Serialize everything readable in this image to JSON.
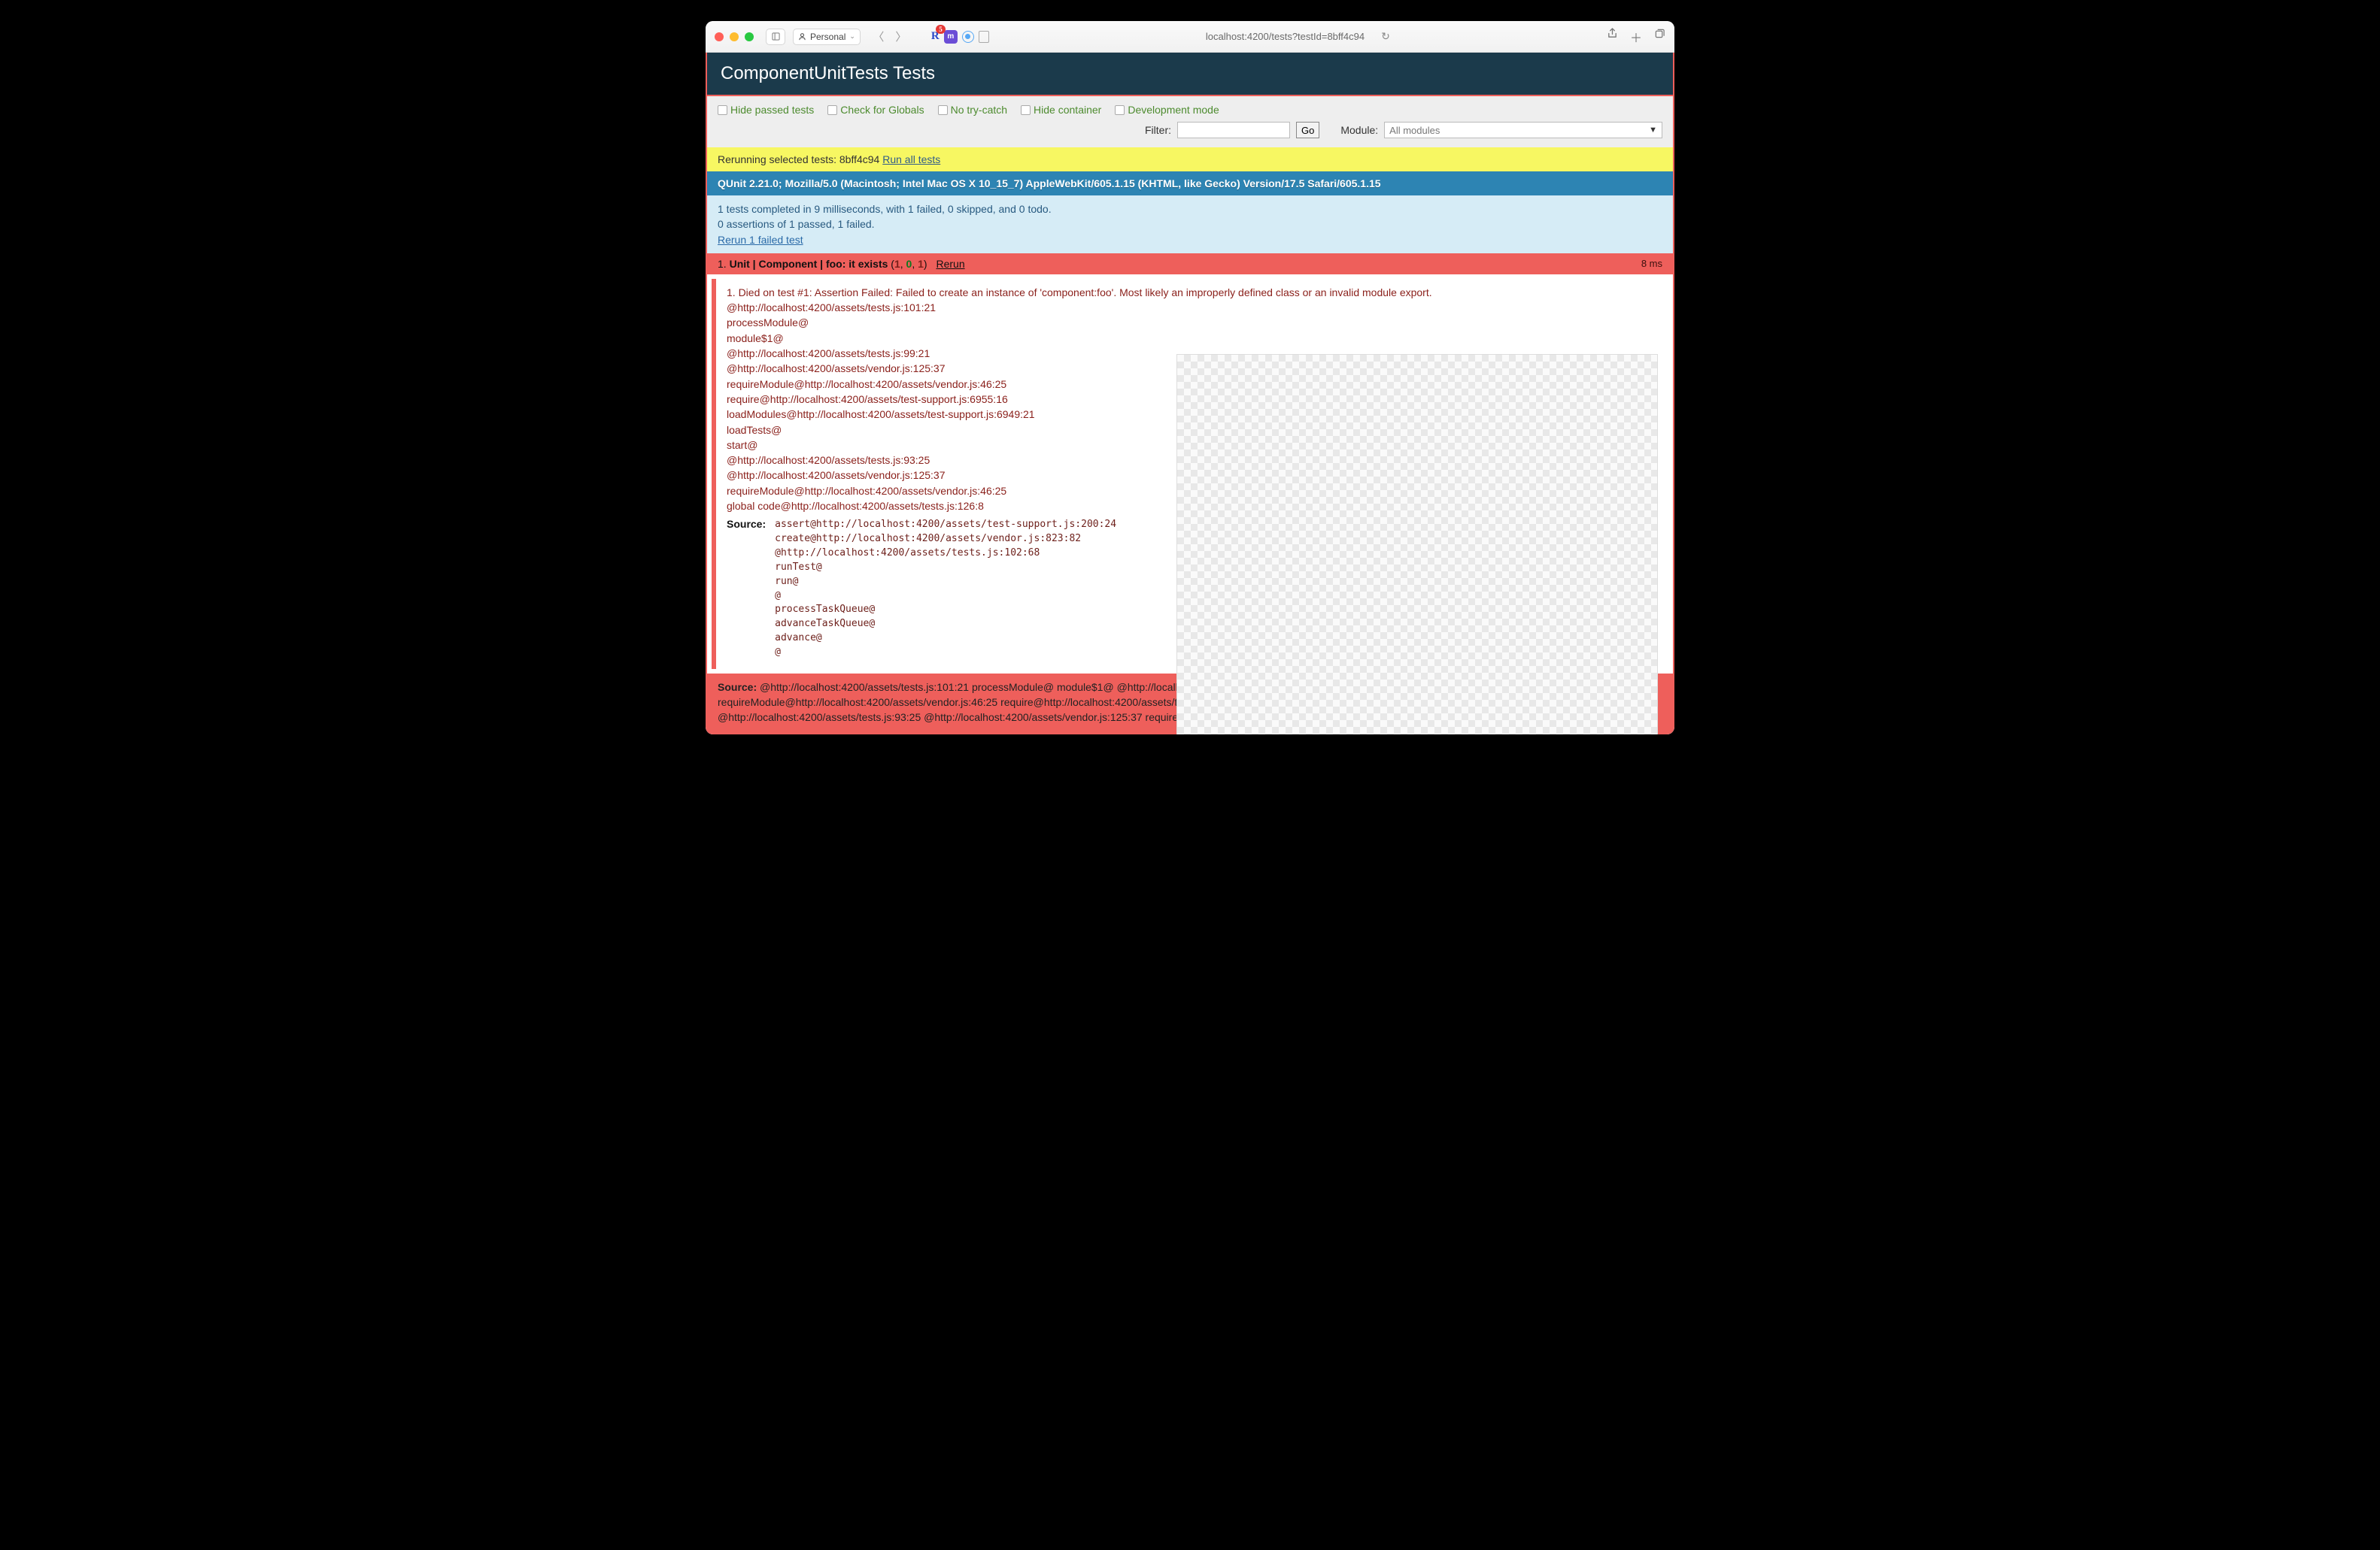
{
  "browser": {
    "profile_label": "Personal",
    "ext_badge": "5",
    "url": "localhost:4200/tests?testId=8bff4c94"
  },
  "header": {
    "title": "ComponentUnitTests Tests"
  },
  "toolbar": {
    "hide_passed": "Hide passed tests",
    "check_globals": "Check for Globals",
    "no_trycatch": "No try-catch",
    "hide_container": "Hide container",
    "dev_mode": "Development mode",
    "filter_label": "Filter:",
    "go_label": "Go",
    "module_label": "Module:",
    "module_placeholder": "All modules"
  },
  "rerun": {
    "text": "Rerunning selected tests: 8bff4c94 ",
    "link": "Run all tests"
  },
  "useragent": "QUnit 2.21.0; Mozilla/5.0 (Macintosh; Intel Mac OS X 10_15_7) AppleWebKit/605.1.15 (KHTML, like Gecko) Version/17.5 Safari/605.1.15",
  "summary": {
    "line1": "1 tests completed in 9 milliseconds, with 1 failed, 0 skipped, and 0 todo.",
    "line2": "0 assertions of 1 passed, 1 failed.",
    "rerun_link": "Rerun 1 failed test"
  },
  "test": {
    "index": "1.",
    "name": "Unit | Component | foo: it exists",
    "counts_open": "(",
    "fail": "1",
    "sep": ", ",
    "pass": "0",
    "total": "1",
    "counts_close": ")",
    "rerun": "Rerun",
    "runtime": "8 ms",
    "trace": "1. Died on test #1: Assertion Failed: Failed to create an instance of 'component:foo'. Most likely an improperly defined class or an invalid module export.\n@http://localhost:4200/assets/tests.js:101:21\nprocessModule@\nmodule$1@\n@http://localhost:4200/assets/tests.js:99:21\n@http://localhost:4200/assets/vendor.js:125:37\nrequireModule@http://localhost:4200/assets/vendor.js:46:25\nrequire@http://localhost:4200/assets/test-support.js:6955:16\nloadModules@http://localhost:4200/assets/test-support.js:6949:21\nloadTests@\nstart@\n@http://localhost:4200/assets/tests.js:93:25\n@http://localhost:4200/assets/vendor.js:125:37\nrequireModule@http://localhost:4200/assets/vendor.js:46:25\nglobal code@http://localhost:4200/assets/tests.js:126:8",
    "source_label": "Source:",
    "source_code": "assert@http://localhost:4200/assets/test-support.js:200:24\ncreate@http://localhost:4200/assets/vendor.js:823:82\n@http://localhost:4200/assets/tests.js:102:68\nrunTest@\nrun@\n@\nprocessTaskQueue@\nadvanceTaskQueue@\nadvance@\n@"
  },
  "footer_source": {
    "label": "Source:",
    "text": " @http://localhost:4200/assets/tests.js:101:21 processModule@ module$1@ @http://localhost:4\nrequireModule@http://localhost:4200/assets/vendor.js:46:25 require@http://localhost:4200/assets/test-su\n@http://localhost:4200/assets/tests.js:93:25 @http://localhost:4200/assets/vendor.js:125:37 requireModu"
  }
}
